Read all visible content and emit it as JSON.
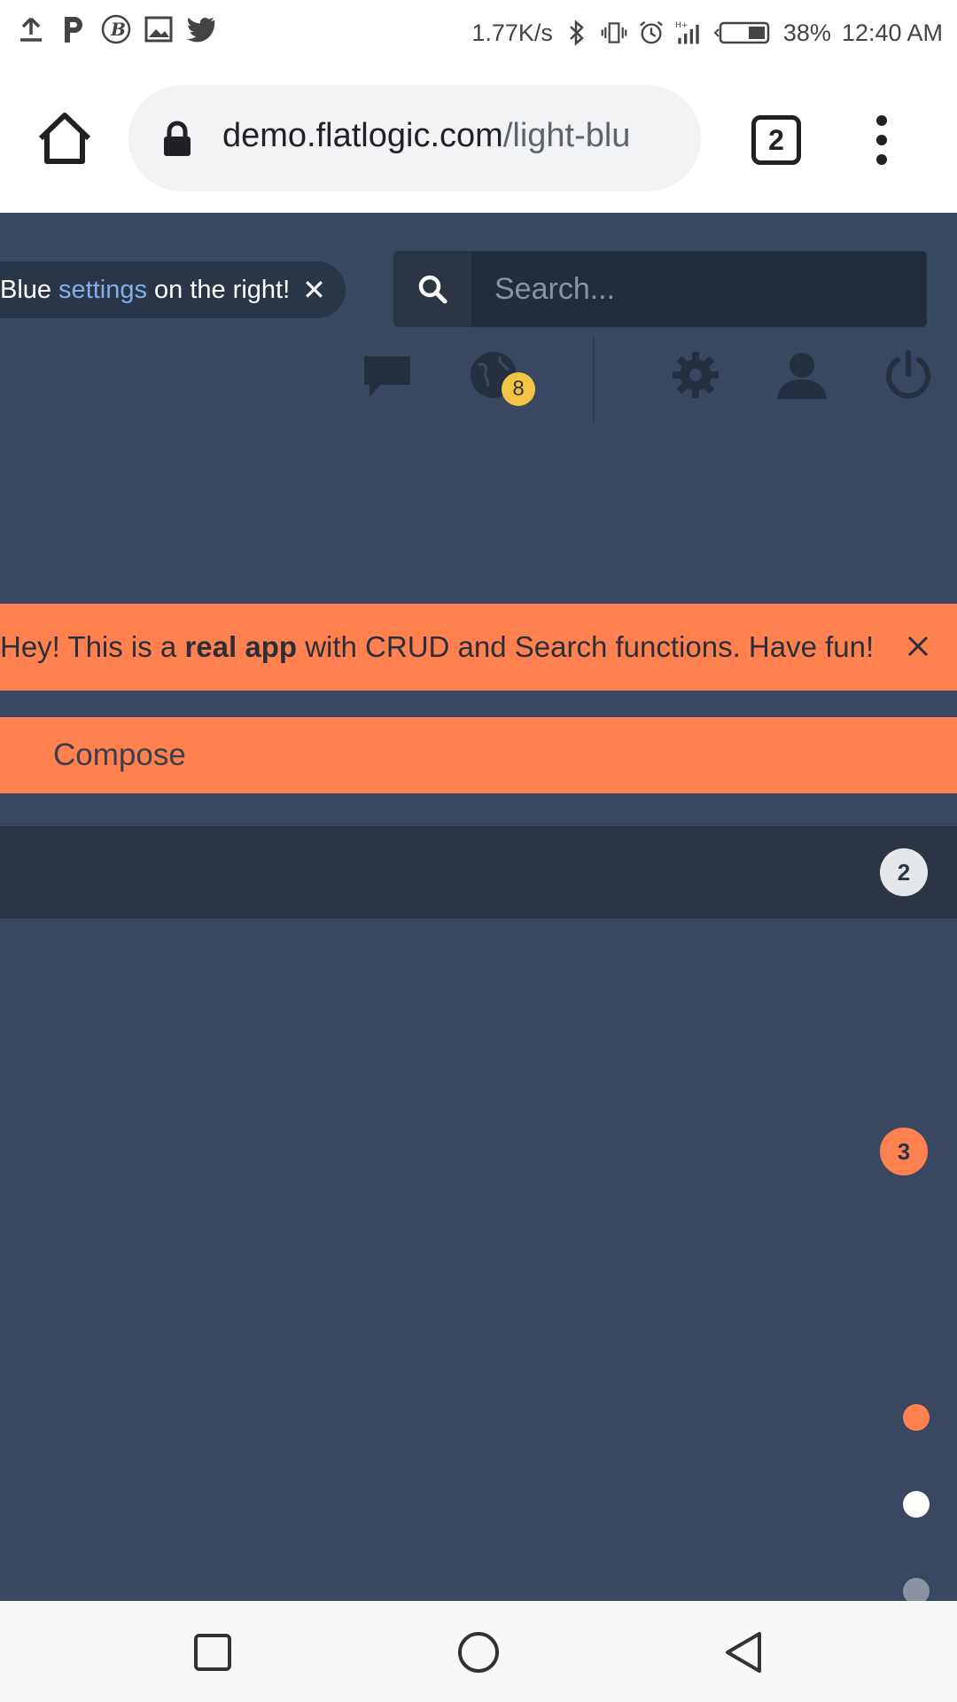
{
  "status_bar": {
    "net_speed": "1.77K/s",
    "battery": "38%",
    "time": "12:40 AM",
    "left_icons": [
      "upload-icon",
      "p-app-icon",
      "b-app-icon",
      "gallery-icon",
      "twitter-icon"
    ],
    "right_icons": [
      "bluetooth-icon",
      "vibrate-icon",
      "alarm-icon",
      "signal-icon",
      "battery-icon"
    ]
  },
  "browser": {
    "url_host": "demo.flatlogic.com",
    "url_path": "/light-blu",
    "tab_count": "2"
  },
  "app": {
    "hint": {
      "prefix": "Blue",
      "link": "settings",
      "suffix": "on the right!",
      "close": "✕"
    },
    "search": {
      "placeholder": "Search..."
    },
    "nav": {
      "notification_badge": "8",
      "icons": [
        "chat-icon",
        "globe-icon",
        "gear-icon",
        "user-icon",
        "power-icon"
      ]
    },
    "alert": {
      "text_before": "Hey! This is a ",
      "text_bold": "real app",
      "text_after": " with CRUD and Search functions. Have fun!"
    },
    "compose_label": "Compose",
    "inbox_count": "2",
    "unread_count": "3",
    "colors": {
      "background": "#3a4760",
      "accent": "#ff8150",
      "dark": "#2b3546",
      "badge_yellow": "#f3c546",
      "link": "#7fb0e9"
    }
  }
}
